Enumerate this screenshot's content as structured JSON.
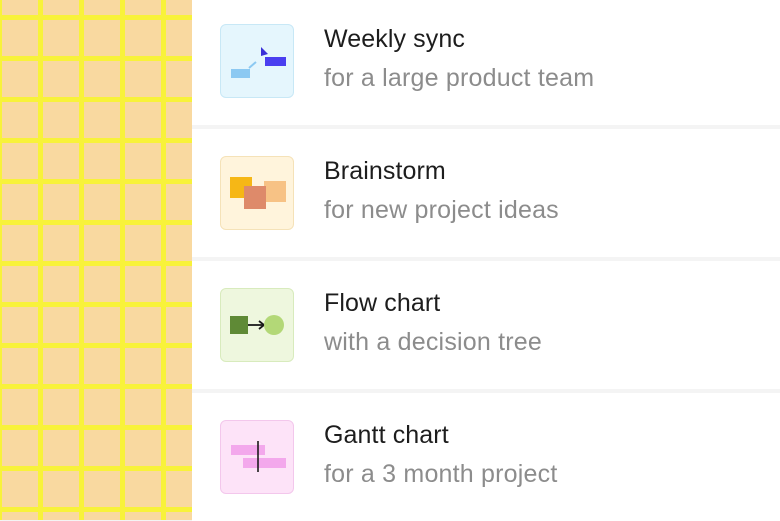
{
  "templates": [
    {
      "title": "Weekly sync",
      "subtitle": "for a large product team",
      "icon": "weekly-sync-icon",
      "thumb_bg": "#e5f6fd",
      "thumb_border": "#c8e8f6"
    },
    {
      "title": "Brainstorm",
      "subtitle": "for new project ideas",
      "icon": "brainstorm-icon",
      "thumb_bg": "#fff4dc",
      "thumb_border": "#f5e2b8"
    },
    {
      "title": "Flow chart",
      "subtitle": "with a decision tree",
      "icon": "flow-chart-icon",
      "thumb_bg": "#eef7de",
      "thumb_border": "#d8ebbd"
    },
    {
      "title": "Gantt chart",
      "subtitle": "for a 3 month project",
      "icon": "gantt-chart-icon",
      "thumb_bg": "#fde3f8",
      "thumb_border": "#f3c7ec"
    }
  ],
  "colors": {
    "grid_bg": "#f9d9a0",
    "grid_line": "#f8f23a",
    "divider": "#f4f4f4"
  }
}
